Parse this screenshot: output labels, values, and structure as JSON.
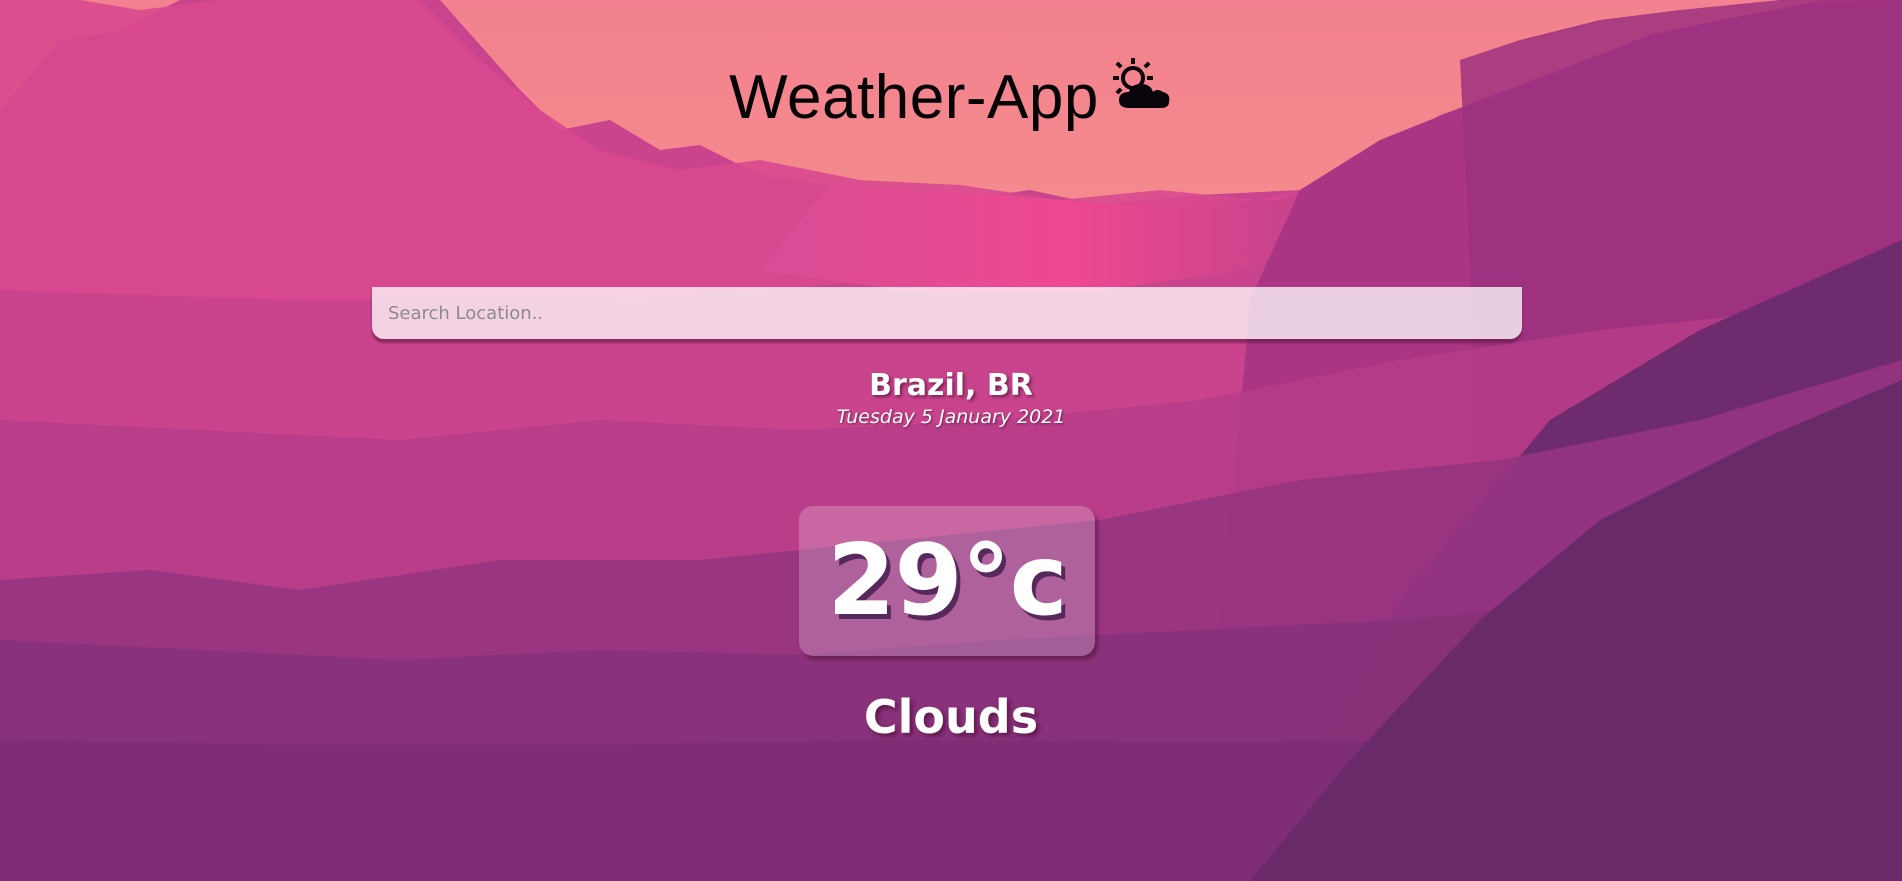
{
  "app": {
    "title": "Weather-App",
    "title_icon": "sun-behind-cloud-icon"
  },
  "search": {
    "placeholder": "Search Location..",
    "value": ""
  },
  "location": {
    "name": "Brazil, BR",
    "date": "Tuesday 5 January 2021"
  },
  "weather": {
    "temperature": "29°c",
    "condition": "Clouds"
  },
  "colors": {
    "sky_top": "#f28794",
    "sky_bottom": "#f5a287",
    "mountain_pink": "#d44a93",
    "mountain_purple": "#8b3379",
    "deep_purple": "#6b2a6c"
  }
}
